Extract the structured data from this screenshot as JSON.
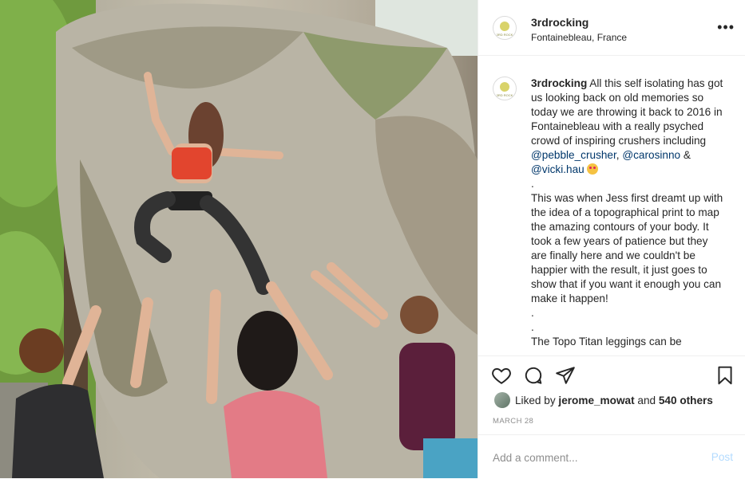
{
  "post": {
    "username": "3rdrocking",
    "location": "Fontainebleau, France",
    "avatar_text": "3RD ROCK",
    "more_icon": "more-options-icon"
  },
  "caption": {
    "username": "3rdrocking",
    "para1_a": " All this self isolating has got us looking back on old memories so today we are throwing it back to 2016 in Fontainebleau with a really psyched crowd of inspiring crushers including ",
    "mention1": "@pebble_crusher",
    "sep1": ",",
    "mention2": "@carosinno",
    "amp": " & ",
    "mention3": "@vicki.hau",
    "dot1": ".",
    "para2": "This was when Jess first dreamt up with the idea of a topographical print to map the amazing contours of your body. It took a few years of patience but they are finally here and we couldn't be happier with the result, it just goes to show that if you want it enough you can make it happen!",
    "dot2": ".",
    "dot3": ".",
    "para3": "The Topo Titan leggings can be"
  },
  "actions": {
    "like_icon": "heart-icon",
    "comment_icon": "comment-icon",
    "share_icon": "send-icon",
    "save_icon": "bookmark-icon"
  },
  "likes": {
    "prefix": "Liked by ",
    "user": "jerome_mowat",
    "mid": " and ",
    "count": "540 others"
  },
  "date": "MARCH 28",
  "comment": {
    "placeholder": "Add a comment...",
    "post_label": "Post"
  }
}
